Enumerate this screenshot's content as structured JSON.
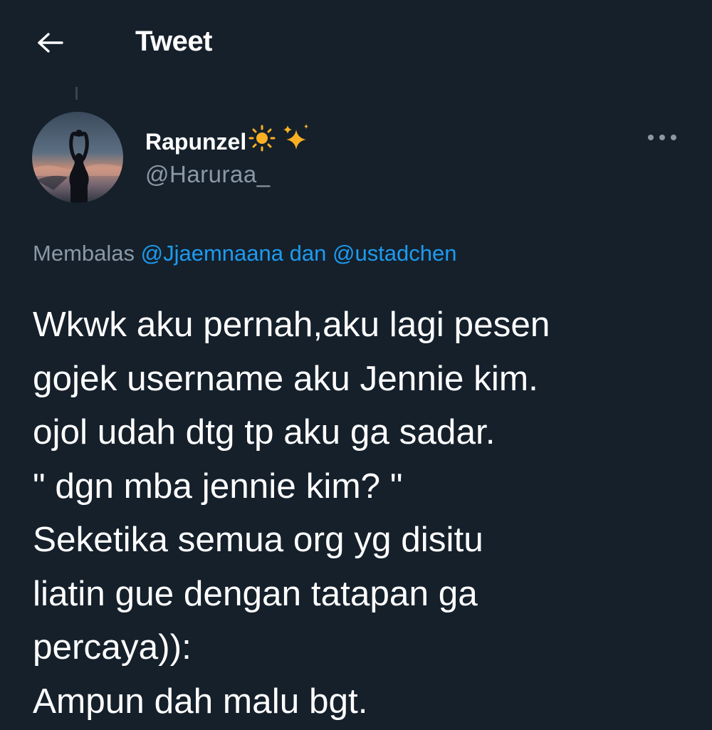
{
  "header": {
    "title": "Tweet",
    "back_icon": "arrow-left-icon"
  },
  "author": {
    "display_name": "Rapunzel",
    "name_emojis": [
      "☀️",
      "✨"
    ],
    "handle": "@Haruraa_",
    "avatar_icon": "avatar-silhouette"
  },
  "more_icon": "more-horizontal-icon",
  "reply_context": {
    "prefix": "Membalas",
    "mention_1": "@Jjaemnaana",
    "joiner": "dan",
    "mention_2": "@ustadchen"
  },
  "tweet": {
    "lines": [
      "Wkwk aku pernah,aku lagi pesen",
      "gojek username aku Jennie kim.",
      "ojol udah dtg tp aku ga sadar.",
      "\" dgn mba jennie kim? \"",
      "Seketika semua org yg disitu",
      "liatin gue dengan tatapan ga",
      "percaya)):",
      "Ampun dah malu bgt."
    ]
  },
  "colors": {
    "background": "#15202b",
    "text": "#ffffff",
    "secondary": "#8b98a5",
    "accent": "#1d9bf0"
  }
}
